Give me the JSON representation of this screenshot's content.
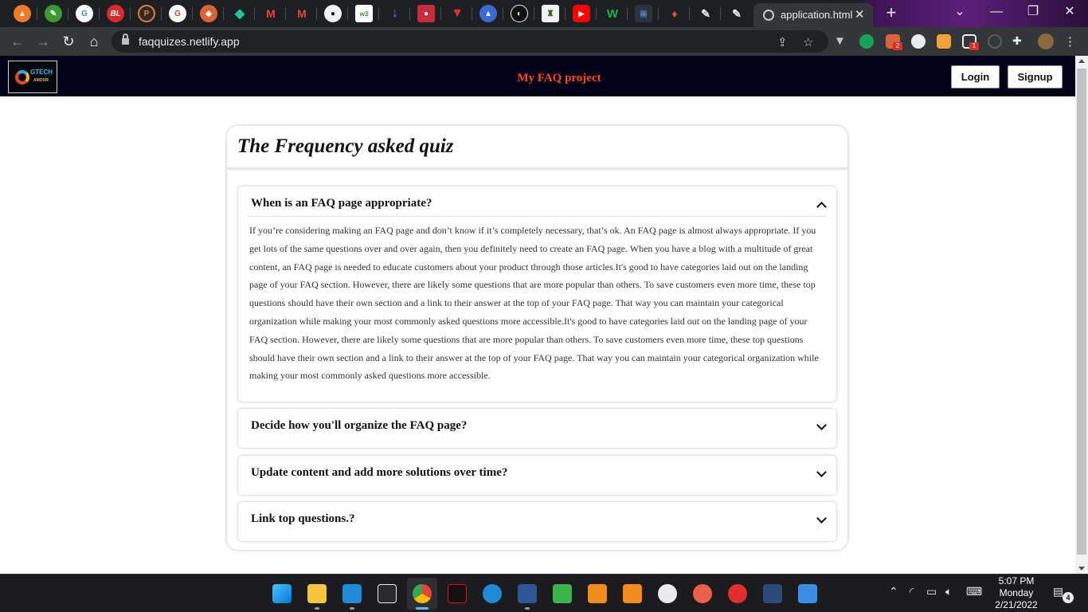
{
  "browser": {
    "active_tab_title": "application.html",
    "url": "faqquizes.netlify.app",
    "extension_badges": [
      "2",
      "1"
    ]
  },
  "site": {
    "logo_line1": "GTECH",
    "logo_line2": "AMOUR",
    "title": "My FAQ project",
    "login_label": "Login",
    "signup_label": "Signup"
  },
  "faq": {
    "heading": "The Frequency asked quiz",
    "items": [
      {
        "question": "When is an FAQ page appropriate?",
        "expanded": true,
        "answer": "If you’re considering making an FAQ page and don’t know if it’s completely necessary, that’s ok. An FAQ page is almost always appropriate. If you get lots of the same questions over and over again, then you definitely need to create an FAQ page. When you have a blog with a multitude of great content, an FAQ page is needed to educate customers about your product through those articles.It's good to have categories laid out on the landing page of your FAQ section. However, there are likely some questions that are more popular than others. To save customers even more time, these top questions should have their own section and a link to their answer at the top of your FAQ page. That way you can maintain your categorical organization while making your most commonly asked questions more accessible.It's good to have categories laid out on the landing page of your FAQ section. However, there are likely some questions that are more popular than others. To save customers even more time, these top questions should have their own section and a link to their answer at the top of your FAQ page. That way you can maintain your categorical organization while making your most commonly asked questions more accessible."
      },
      {
        "question": "Decide how you'll organize the FAQ page?",
        "expanded": false
      },
      {
        "question": "Update content and add more solutions over time?",
        "expanded": false
      },
      {
        "question": "Link top questions.?",
        "expanded": false
      }
    ]
  },
  "taskbar": {
    "time": "5:07 PM",
    "day": "Monday",
    "date": "2/21/2022",
    "notification_count": "4"
  },
  "colors": {
    "site_header_bg": "#020318",
    "site_title": "#ff4a1c",
    "chrome_bg": "#35363a"
  }
}
